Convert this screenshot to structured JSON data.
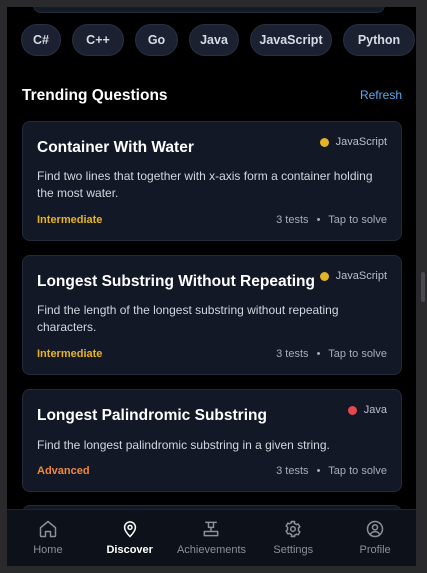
{
  "languages": [
    "C#",
    "C++",
    "Go",
    "Java",
    "JavaScript",
    "Python"
  ],
  "section": {
    "title": "Trending Questions",
    "refresh_label": "Refresh"
  },
  "questions": [
    {
      "title": "Container With Water",
      "language": "JavaScript",
      "language_color": "#e6b422",
      "description": "Find two lines that together with x-axis form a container holding the most water.",
      "level": "Intermediate",
      "level_color": "#e6b422",
      "tests": "3 tests",
      "separator": "•",
      "action": "Tap to solve"
    },
    {
      "title": "Longest Substring Without Repeating",
      "language": "JavaScript",
      "language_color": "#e6b422",
      "description": "Find the length of the longest substring without repeating characters.",
      "level": "Intermediate",
      "level_color": "#e6b422",
      "tests": "3 tests",
      "separator": "•",
      "action": "Tap to solve"
    },
    {
      "title": "Longest Palindromic Substring",
      "language": "Java",
      "language_color": "#e5484d",
      "description": "Find the longest palindromic substring in a given string.",
      "level": "Advanced",
      "level_color": "#f08a3c",
      "tests": "3 tests",
      "separator": "•",
      "action": "Tap to solve"
    }
  ],
  "tabs": [
    {
      "label": "Home",
      "icon": "home-icon"
    },
    {
      "label": "Discover",
      "icon": "location-pin-icon",
      "active": true
    },
    {
      "label": "Achievements",
      "icon": "podium-icon"
    },
    {
      "label": "Settings",
      "icon": "settings-icon"
    },
    {
      "label": "Profile",
      "icon": "profile-icon"
    }
  ]
}
